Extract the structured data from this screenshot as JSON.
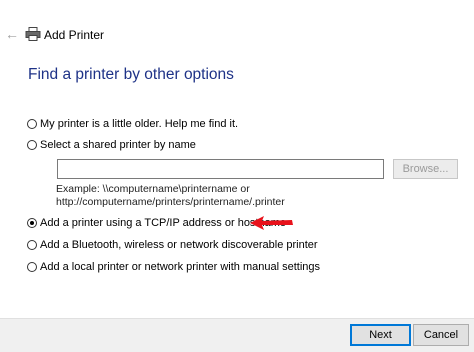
{
  "window": {
    "title": "Add Printer",
    "back_icon": "back-arrow-icon",
    "app_icon": "printer-icon"
  },
  "heading": "Find a printer by other options",
  "options": [
    {
      "label": "My printer is a little older. Help me find it.",
      "selected": false
    },
    {
      "label": "Select a shared printer by name",
      "selected": false
    },
    {
      "label": "Add a printer using a TCP/IP address or hostname",
      "selected": true
    },
    {
      "label": "Add a Bluetooth, wireless or network discoverable printer",
      "selected": false
    },
    {
      "label": "Add a local printer or network printer with manual settings",
      "selected": false
    }
  ],
  "shared_printer": {
    "value": "",
    "browse_label": "Browse...",
    "example_line1": "Example: \\\\computername\\printername or",
    "example_line2": "http://computername/printers/printername/.printer"
  },
  "annotation": {
    "arrow_color": "#e8121b",
    "icon": "red-arrow-icon"
  },
  "footer": {
    "next_label": "Next",
    "cancel_label": "Cancel"
  },
  "colors": {
    "heading": "#1e3287",
    "accent": "#0078d7"
  }
}
